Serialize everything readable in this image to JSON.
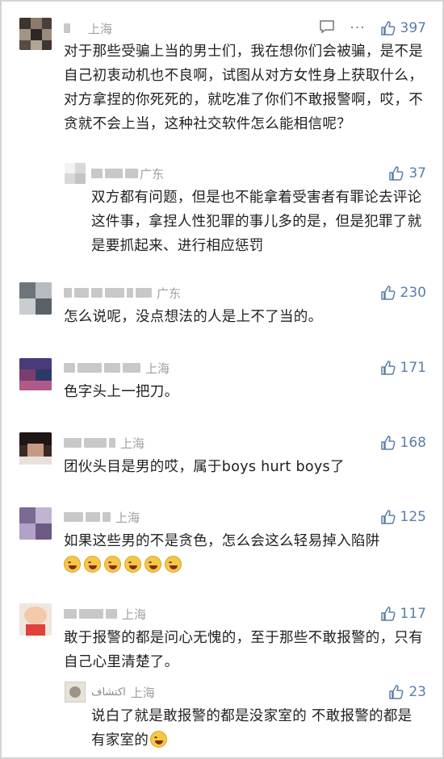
{
  "colors": {
    "accent": "#5a7ea8",
    "location": "#a0a0a0",
    "text": "#1f1f1f",
    "background": "#ffffff"
  },
  "icons": {
    "like": "thumbs-up-icon",
    "reply": "message-icon",
    "more": "more-icon"
  },
  "comments": [
    {
      "location": "上海",
      "likes": "397",
      "text": "对于那些受骗上当的男士们，我在想你们会被骗，是不是自己初衷动机也不良啊，试图从对方女性身上获取什么，对方拿捏的你死死的，就吃准了你们不敢报警啊，哎，不贪就不会上当，这种社交软件怎么能相信呢？",
      "reply": {
        "location": "广东",
        "likes": "37",
        "text": "双方都有问题，但是也不能拿着受害者有罪论去评论这件事，拿捏人性犯罪的事儿多的是，但是犯罪了就是要抓起来、进行相应惩罚"
      }
    },
    {
      "location": "广东",
      "likes": "230",
      "text": "怎么说呢，没点想法的人是上不了当的。"
    },
    {
      "location": "上海",
      "likes": "171",
      "text": "色字头上一把刀。"
    },
    {
      "location": "上海",
      "likes": "168",
      "text": "团伙头目是男的哎，属于boys hurt boys了"
    },
    {
      "location": "上海",
      "likes": "125",
      "text": "如果这些男的不是贪色，怎么会这么轻易掉入陷阱"
    },
    {
      "location": "上海",
      "likes": "117",
      "text": "敢于报警的都是问心无愧的，至于那些不敢报警的，只有自己心里清楚了。",
      "reply": {
        "name": "اكتشاف",
        "location": "上海",
        "likes": "23",
        "text": "说白了就是敢报警的都是没家室的 不敢报警的都是有家室的"
      }
    }
  ],
  "more_label": "···"
}
